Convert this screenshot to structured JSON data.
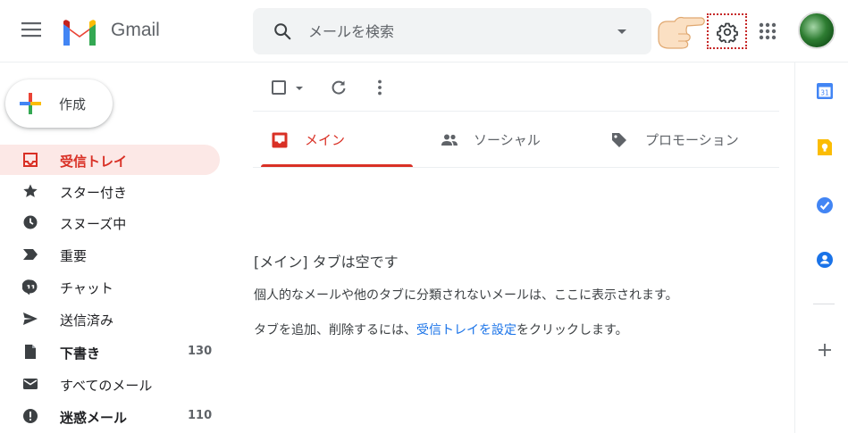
{
  "header": {
    "brand": "Gmail",
    "search_placeholder": "メールを検索"
  },
  "compose": {
    "label": "作成"
  },
  "sidebar": {
    "items": [
      {
        "label": "受信トレイ",
        "count": "",
        "active": true
      },
      {
        "label": "スター付き",
        "count": ""
      },
      {
        "label": "スヌーズ中",
        "count": ""
      },
      {
        "label": "重要",
        "count": ""
      },
      {
        "label": "チャット",
        "count": ""
      },
      {
        "label": "送信済み",
        "count": ""
      },
      {
        "label": "下書き",
        "count": "130",
        "bold": true
      },
      {
        "label": "すべてのメール",
        "count": ""
      },
      {
        "label": "迷惑メール",
        "count": "110",
        "bold": true
      }
    ]
  },
  "tabs": [
    {
      "label": "メイン",
      "active": true
    },
    {
      "label": "ソーシャル"
    },
    {
      "label": "プロモーション"
    }
  ],
  "empty_state": {
    "title": "[メイン] タブは空です",
    "description": "個人的なメールや他のタブに分類されないメールは、ここに表示されます。",
    "hint_prefix": "タブを追加、削除するには、",
    "hint_link": "受信トレイを設定",
    "hint_suffix": "をクリックします。"
  },
  "icons": {
    "menu": "hamburger-menu-icon",
    "search": "search-icon",
    "settings": "gear-icon",
    "apps": "apps-grid-icon"
  },
  "colors": {
    "accent_red": "#d93025",
    "link_blue": "#1a73e8",
    "active_bg": "#fce8e6"
  }
}
